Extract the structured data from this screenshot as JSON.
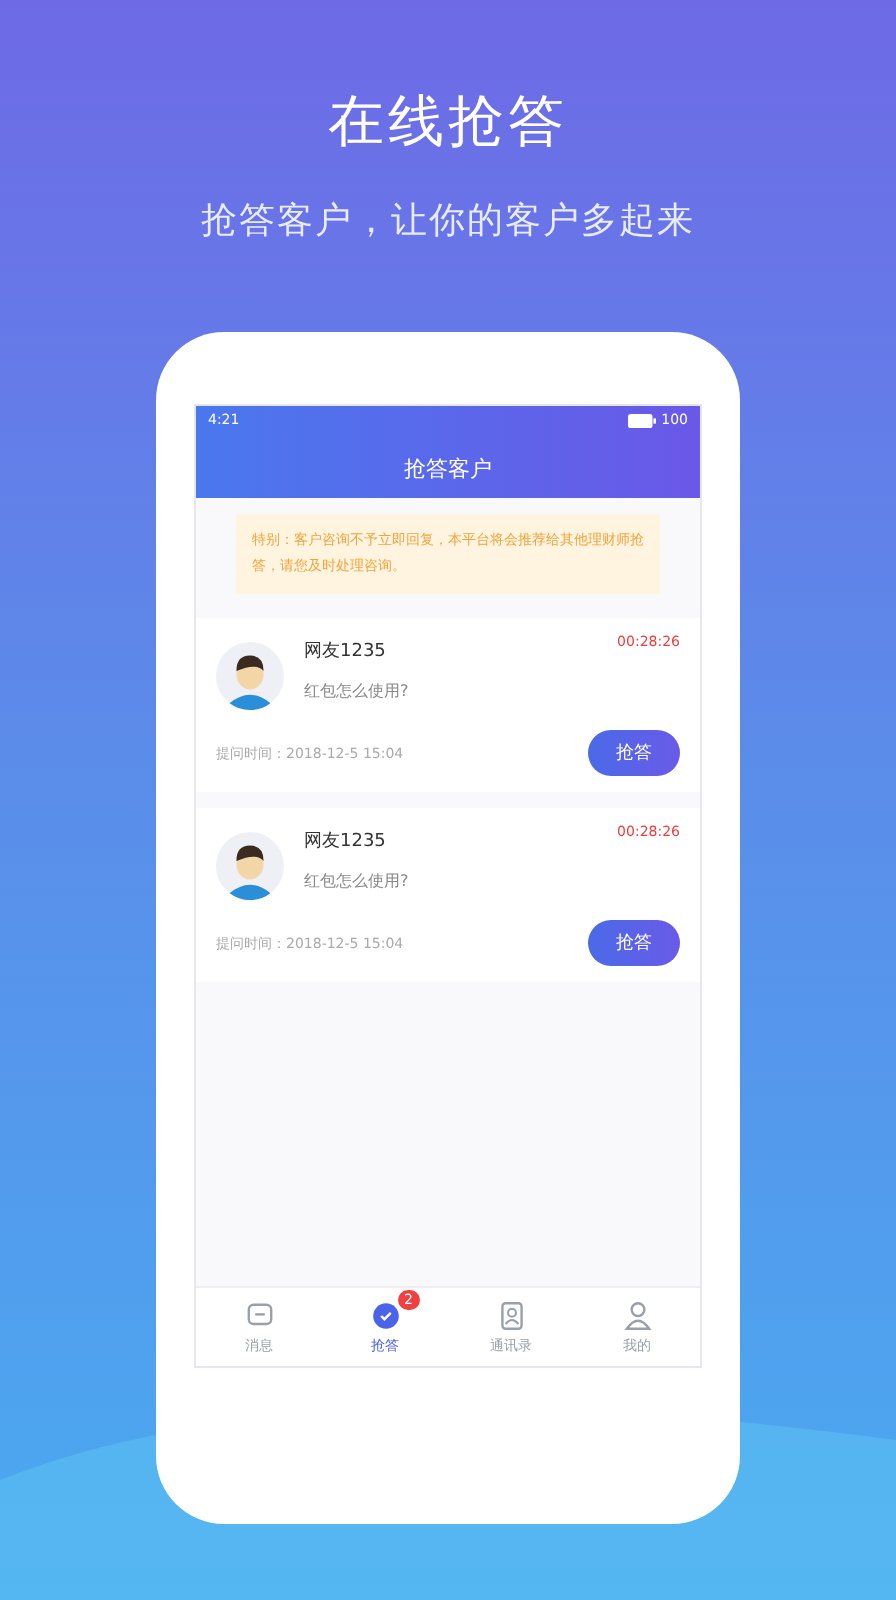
{
  "headline": "在线抢答",
  "subheadline": "抢答客户，让你的客户多起来",
  "status_bar": {
    "time": "4:21",
    "battery": "100"
  },
  "header": {
    "title": "抢答客户"
  },
  "notice": "特别：客户咨询不予立即回复，本平台将会推荐给其他理财师抢答，请您及时处理咨询。",
  "cards": [
    {
      "name": "网友1235",
      "question": "红包怎么使用?",
      "countdown": "00:28:26",
      "time": "提问时间：2018-12-5  15:04",
      "button": "抢答"
    },
    {
      "name": "网友1235",
      "question": "红包怎么使用?",
      "countdown": "00:28:26",
      "time": "提问时间：2018-12-5  15:04",
      "button": "抢答"
    }
  ],
  "tabs": [
    {
      "kind": "chat",
      "label": "消息",
      "selected": false
    },
    {
      "kind": "grab",
      "label": "抢答",
      "selected": true,
      "badge": "2"
    },
    {
      "kind": "contacts",
      "label": "通讯录",
      "selected": false
    },
    {
      "kind": "profile",
      "label": "我的",
      "selected": false
    }
  ]
}
